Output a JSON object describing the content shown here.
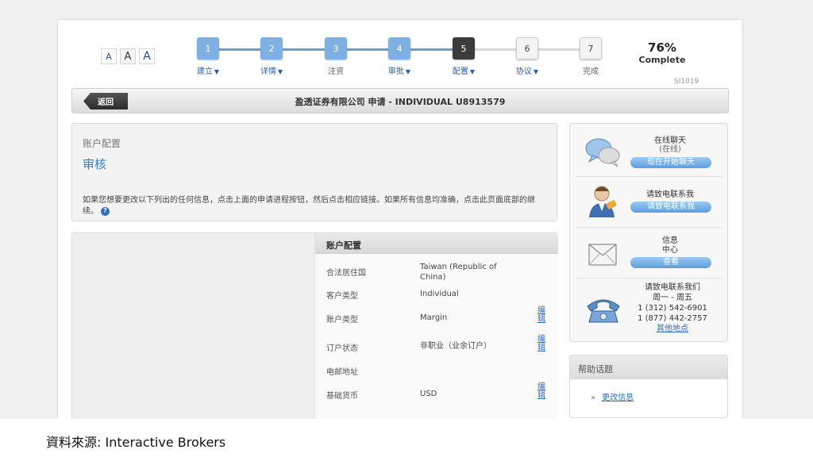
{
  "caption": "資料來源: Interactive Brokers",
  "font_sizes": [
    "A",
    "A",
    "A"
  ],
  "progress": {
    "steps": [
      {
        "num": "1",
        "label": "建立",
        "state": "done",
        "dropdown": true
      },
      {
        "num": "2",
        "label": "详情",
        "state": "done",
        "dropdown": true
      },
      {
        "num": "3",
        "label": "注资",
        "state": "done",
        "dropdown": false
      },
      {
        "num": "4",
        "label": "审批",
        "state": "done",
        "dropdown": true
      },
      {
        "num": "5",
        "label": "配置",
        "state": "current",
        "dropdown": true
      },
      {
        "num": "6",
        "label": "协议",
        "state": "todo",
        "dropdown": true
      },
      {
        "num": "7",
        "label": "完成",
        "state": "todo",
        "dropdown": false
      }
    ],
    "percent": "76%",
    "complete_label": "Complete",
    "form_id": "SI1019"
  },
  "titlebar": {
    "back_label": "返回",
    "title": "盈透证券有限公司 申请 - INDIVIDUAL U8913579"
  },
  "main": {
    "section_label": "账户配置",
    "review_heading": "审核",
    "instructions": "如果您想要更改以下列出的任何信息，点击上面的申请进程按钮，然后点击相应链接。如果所有信息均准确，点击此页面底部的继续。",
    "help_icon": "?"
  },
  "config": {
    "header": "账户配置",
    "edit_label": "编辑",
    "rows": [
      {
        "key": "合法居住国",
        "value": "Taiwan (Republic of China)",
        "editable": false
      },
      {
        "key": "客户类型",
        "value": "Individual",
        "editable": false
      },
      {
        "key": "账户类型",
        "value": "Margin",
        "editable": true
      },
      {
        "key": "订户状态",
        "value": "非职业（业余订户）",
        "editable": true
      },
      {
        "key": "电邮地址",
        "value": "",
        "editable": false
      },
      {
        "key": "基础货币",
        "value": "USD",
        "editable": true
      }
    ]
  },
  "sidebar": {
    "chat": {
      "title": "在线聊天",
      "status": "(在线)",
      "button": "现在开始聊天",
      "icon": "chat-bubbles-icon"
    },
    "callback": {
      "title": "请致电联系我",
      "button": "请致电联系我",
      "icon": "support-agent-icon"
    },
    "messages": {
      "title": "信息\n中心",
      "button": "查看",
      "icon": "envelope-icon"
    },
    "phone": {
      "title": "请致电联系我们",
      "hours": "周一 - 周五",
      "phone1": "1 (312) 542-6901",
      "phone2": "1 (877) 442-2757",
      "other_link": "其他地点",
      "icon": "telephone-icon"
    }
  },
  "help_topics": {
    "header": "帮助话题",
    "bullet": "»",
    "link": "更改信息"
  }
}
